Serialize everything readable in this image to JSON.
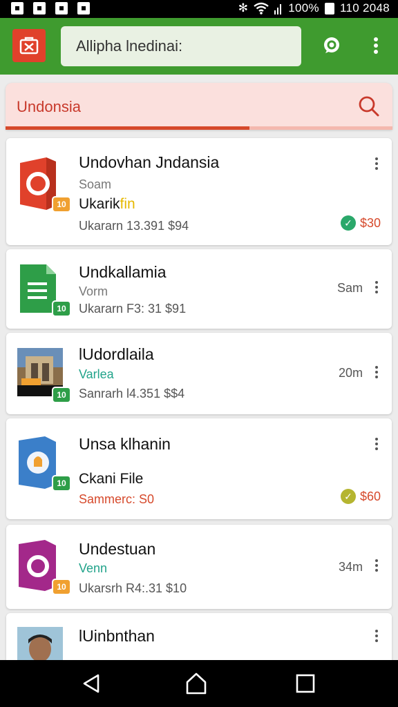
{
  "status_bar": {
    "battery": "100%",
    "time": "110 2048"
  },
  "app_bar": {
    "search_text": "Allipha lnedinai:"
  },
  "search": {
    "query": "Undonsia",
    "progress": 0.63
  },
  "items": [
    {
      "title": "Undovhan Jndansia",
      "line1": "Soam",
      "line2_a": "Ukarik",
      "line2_b": "fin",
      "line3": "Ukararn 13.391 $94",
      "status": "$30",
      "badge": "10"
    },
    {
      "title": "Undkallamia",
      "line1": "Vorm",
      "line2": "Ukararn F3: 31 $91",
      "right": "Sam",
      "badge": "10"
    },
    {
      "title": "lUdordlaila",
      "line1": "Varlea",
      "line2": "Sanrarh l4.351 $$4",
      "right": "20m",
      "badge": "10"
    },
    {
      "title": "Unsa klhanin",
      "line1": "Ckani File",
      "line2": "Sammerc: S0",
      "status": "$60",
      "badge": "10"
    },
    {
      "title": "Undestuan",
      "line1": "Venn",
      "line2": "Ukarsrh R4:.31 $10",
      "right": "34m",
      "badge": "10"
    },
    {
      "title": "lUinbnthan"
    }
  ],
  "icons": [
    "app-logo-icon",
    "search-icon",
    "chat-icon",
    "more-vert-icon",
    "back-icon",
    "home-icon",
    "recents-icon",
    "check-circle-icon"
  ],
  "colors": {
    "app_bar": "#3f9b2f",
    "accent_red": "#d6492b",
    "teal": "#21a38a",
    "check_green": "#2aa86a",
    "check_olive": "#b5b530"
  }
}
